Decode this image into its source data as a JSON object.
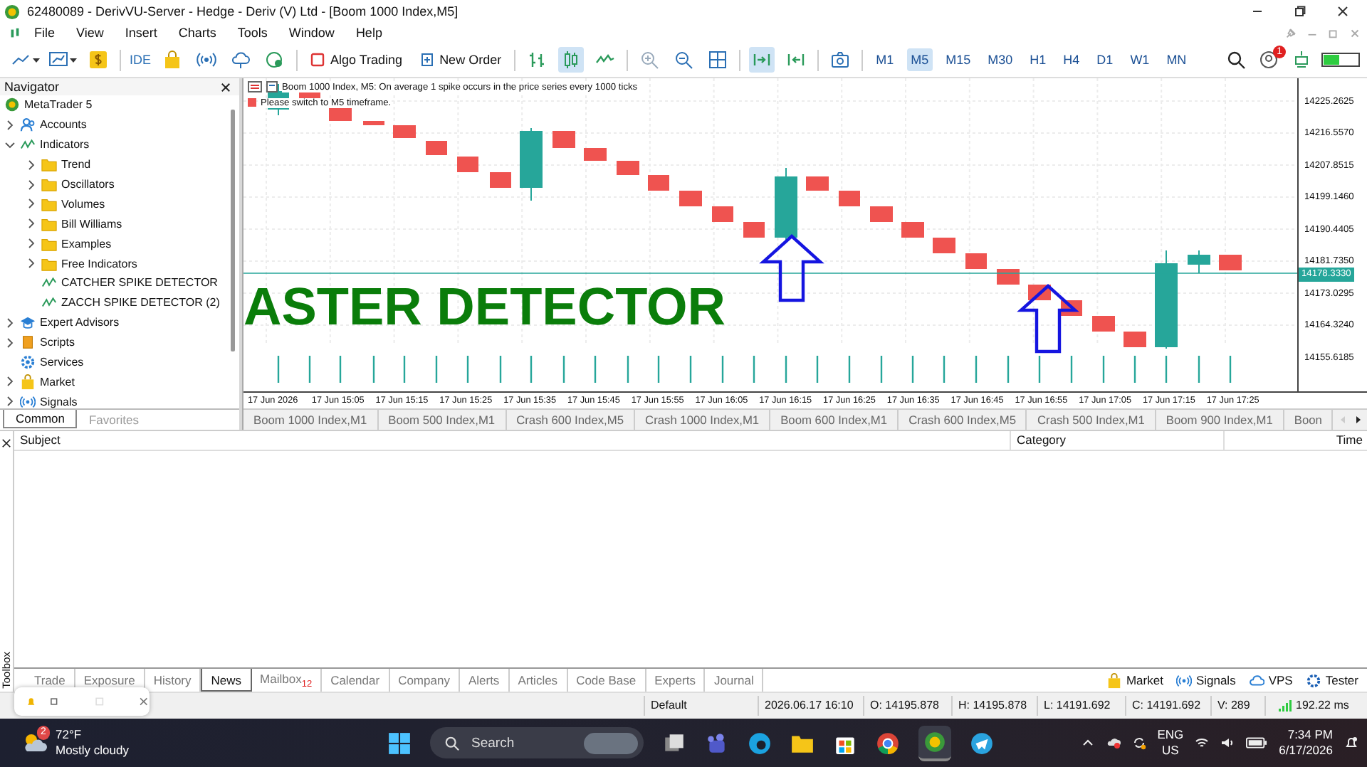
{
  "window": {
    "title": "62480089 - DerivVU-Server - Hedge - Deriv (V) Ltd - [Boom 1000 Index,M5]"
  },
  "menu": [
    "File",
    "View",
    "Insert",
    "Charts",
    "Tools",
    "Window",
    "Help"
  ],
  "toolbar": {
    "ide_label": "IDE",
    "algo_trading": "Algo Trading",
    "new_order": "New Order",
    "notification_count": "1",
    "timeframes": [
      {
        "label": "M1",
        "selected": false
      },
      {
        "label": "M5",
        "selected": true
      },
      {
        "label": "M15",
        "selected": false
      },
      {
        "label": "M30",
        "selected": false
      },
      {
        "label": "H1",
        "selected": false
      },
      {
        "label": "H4",
        "selected": false
      },
      {
        "label": "D1",
        "selected": false
      },
      {
        "label": "W1",
        "selected": false
      },
      {
        "label": "MN",
        "selected": false
      }
    ]
  },
  "navigator": {
    "title": "Navigator",
    "tree": [
      {
        "label": "MetaTrader 5",
        "kind": "root",
        "children": [
          {
            "label": "Accounts",
            "kind": "account",
            "expanded": false
          },
          {
            "label": "Indicators",
            "kind": "indicator",
            "expanded": true,
            "children": [
              {
                "label": "Trend",
                "kind": "folder",
                "expanded": false
              },
              {
                "label": "Oscillators",
                "kind": "folder",
                "expanded": false
              },
              {
                "label": "Volumes",
                "kind": "folder",
                "expanded": false
              },
              {
                "label": "Bill Williams",
                "kind": "folder",
                "expanded": false
              },
              {
                "label": "Examples",
                "kind": "folder",
                "expanded": false
              },
              {
                "label": "Free Indicators",
                "kind": "folder",
                "expanded": false
              },
              {
                "label": "CATCHER SPIKE DETECTOR",
                "kind": "indicator"
              },
              {
                "label": "ZACCH SPIKE DETECTOR (2)",
                "kind": "indicator"
              }
            ]
          },
          {
            "label": "Expert Advisors",
            "kind": "expert",
            "expanded": false
          },
          {
            "label": "Scripts",
            "kind": "script",
            "expanded": false
          },
          {
            "label": "Services",
            "kind": "service"
          },
          {
            "label": "Market",
            "kind": "market",
            "expanded": false
          },
          {
            "label": "Signals",
            "kind": "signals",
            "expanded": false
          }
        ]
      }
    ],
    "tabs": [
      {
        "label": "Common",
        "selected": true
      },
      {
        "label": "Favorites",
        "selected": false
      }
    ]
  },
  "chart": {
    "info_line": "Boom 1000 Index, M5:  On average 1 spike occurs in the price series every 1000 ticks",
    "notice": "Please switch to M5 timeframe.",
    "overlay_text": "ASTER DETECTOR",
    "price_labels": [
      "14225.2625",
      "14216.5570",
      "14207.8515",
      "14199.1460",
      "14190.4405",
      "14181.7350",
      "14173.0295",
      "14164.3240",
      "14155.6185"
    ],
    "current_price": "14178.3330",
    "time_labels": [
      "17 Jun 2026",
      "17 Jun 15:05",
      "17 Jun 15:15",
      "17 Jun 15:25",
      "17 Jun 15:35",
      "17 Jun 15:45",
      "17 Jun 15:55",
      "17 Jun 16:05",
      "17 Jun 16:15",
      "17 Jun 16:25",
      "17 Jun 16:35",
      "17 Jun 16:45",
      "17 Jun 16:55",
      "17 Jun 17:05",
      "17 Jun 17:15",
      "17 Jun 17:25"
    ]
  },
  "chart_tabs": [
    {
      "label": "Boom 1000 Index,M1",
      "selected": false
    },
    {
      "label": "Boom 500 Index,M1",
      "selected": false
    },
    {
      "label": "Crash 600 Index,M5",
      "selected": false
    },
    {
      "label": "Crash 1000 Index,M1",
      "selected": false
    },
    {
      "label": "Boom 600 Index,M1",
      "selected": false
    },
    {
      "label": "Crash 600 Index,M5",
      "selected": false
    },
    {
      "label": "Crash 500 Index,M1",
      "selected": false
    },
    {
      "label": "Boom 900 Index,M1",
      "selected": false
    },
    {
      "label": "Boon",
      "selected": false
    }
  ],
  "toolbox": {
    "title": "Toolbox",
    "columns": [
      "Subject",
      "Category",
      "Time"
    ],
    "tabs": [
      {
        "label": "Trade",
        "selected": false
      },
      {
        "label": "Exposure",
        "selected": false
      },
      {
        "label": "History",
        "selected": false
      },
      {
        "label": "News",
        "selected": true
      },
      {
        "label": "Mailbox",
        "badge": "12",
        "selected": false
      },
      {
        "label": "Calendar",
        "selected": false
      },
      {
        "label": "Company",
        "selected": false
      },
      {
        "label": "Alerts",
        "selected": false
      },
      {
        "label": "Articles",
        "selected": false
      },
      {
        "label": "Code Base",
        "selected": false
      },
      {
        "label": "Experts",
        "selected": false
      },
      {
        "label": "Journal",
        "selected": false
      }
    ],
    "services": [
      {
        "label": "Market",
        "kind": "market"
      },
      {
        "label": "Signals",
        "kind": "signals"
      },
      {
        "label": "VPS",
        "kind": "vps"
      },
      {
        "label": "Tester",
        "kind": "tester"
      }
    ]
  },
  "status_bar": {
    "profile": "Default",
    "datetime": "2026.06.17 16:10",
    "open": "O: 14195.878",
    "high": "H: 14195.878",
    "low": "L: 14191.692",
    "close": "C: 14191.692",
    "volume": "V: 289",
    "ping": "192.22 ms"
  },
  "taskbar": {
    "weather_badge": "2",
    "temperature": "72°F",
    "weather": "Mostly cloudy",
    "search_placeholder": "Search",
    "language": "ENG",
    "region": "US",
    "time": "7:34 PM",
    "date": "6/17/2026"
  }
}
